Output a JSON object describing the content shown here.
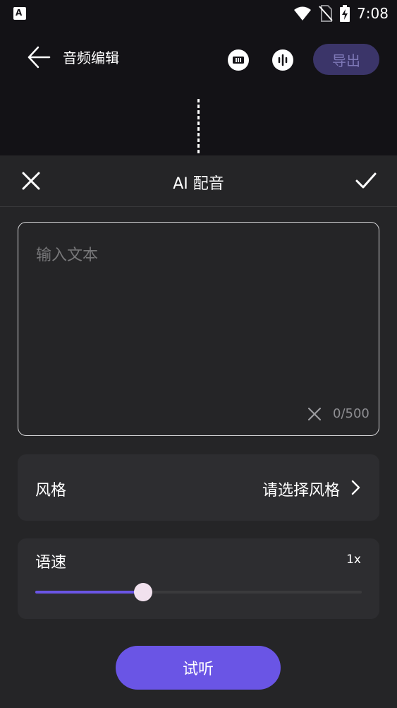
{
  "status_bar": {
    "time": "7:08",
    "icons": [
      "app-notification-icon",
      "wifi-icon",
      "no-sim-icon",
      "battery-charging-icon"
    ]
  },
  "header": {
    "title": "音频编辑",
    "export_label": "导出",
    "icons": [
      "back-arrow-icon",
      "audio-clip-icon",
      "waveform-icon"
    ]
  },
  "sheet": {
    "title": "AI 配音",
    "text_input": {
      "placeholder": "输入文本",
      "counter": "0/500"
    },
    "style": {
      "label": "风格",
      "value": "请选择风格"
    },
    "speed": {
      "label": "语速",
      "value": "1x",
      "slider_fraction": 0.33
    },
    "listen_label": "试听"
  },
  "colors": {
    "accent": "#6a55e5",
    "export_bg": "#3b3569",
    "sheet_bg": "#252527",
    "row_bg": "#2d2d30"
  }
}
